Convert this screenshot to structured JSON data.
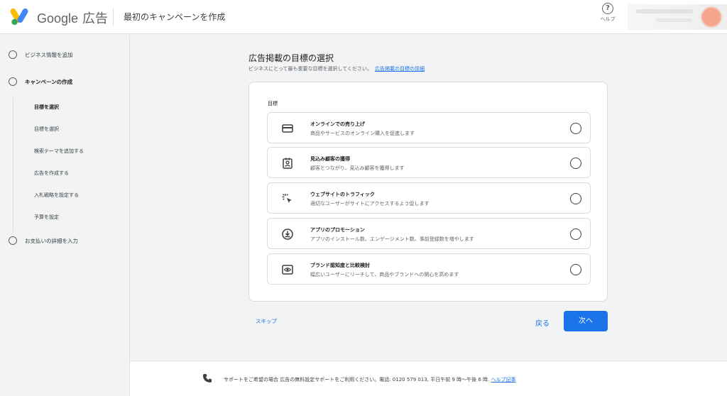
{
  "header": {
    "brand_name": "Google",
    "brand_product": "広告",
    "page_title": "最初のキャンペーンを作成",
    "help_label": "ヘルプ"
  },
  "sidebar": {
    "steps": [
      {
        "label": "ビジネス情報を追加"
      },
      {
        "label": "キャンペーンの作成"
      },
      {
        "label": "お支払いの詳細を入力"
      }
    ],
    "substeps": [
      {
        "label": "目標を選択"
      },
      {
        "label": "目標を選択"
      },
      {
        "label": "検索テーマを追加する"
      },
      {
        "label": "広告を作成する"
      },
      {
        "label": "入札戦略を設定する"
      },
      {
        "label": "予算を設定"
      }
    ]
  },
  "main": {
    "title": "広告掲載の目標の選択",
    "subtitle": "ビジネスにとって最も重要な目標を選択してください。",
    "subtitle_link": "広告掲載の目標の詳細",
    "card_label": "目標",
    "options": [
      {
        "title": "オンラインでの売り上げ",
        "desc": "商品やサービスのオンライン購入を促進します",
        "icon": "credit-card-icon"
      },
      {
        "title": "見込み顧客の獲得",
        "desc": "顧客とつながり、見込み顧客を獲得します",
        "icon": "contact-card-icon"
      },
      {
        "title": "ウェブサイトのトラフィック",
        "desc": "適切なユーザーがサイトにアクセスするよう促します",
        "icon": "cursor-click-icon"
      },
      {
        "title": "アプリのプロモーション",
        "desc": "アプリのインストール数、エンゲージメント数、事前登録数を増やします",
        "icon": "download-circle-icon"
      },
      {
        "title": "ブランド認知度と比較検討",
        "desc": "幅広いユーザーにリーチして、商品やブランドへの関心を高めます",
        "icon": "eye-icon"
      }
    ],
    "skip_label": "スキップ",
    "back_label": "戻る",
    "next_label": "次へ"
  },
  "footer": {
    "text": "サポートをご希望の場合 広告の無料設定サポートをご利用ください。電話: 0120 579 013, 平日午前 9 時〜午後 6 時.",
    "link": "ヘルプ記事"
  },
  "colors": {
    "accent": "#1a73e8",
    "background": "#f1f3f4",
    "card": "#ffffff"
  }
}
